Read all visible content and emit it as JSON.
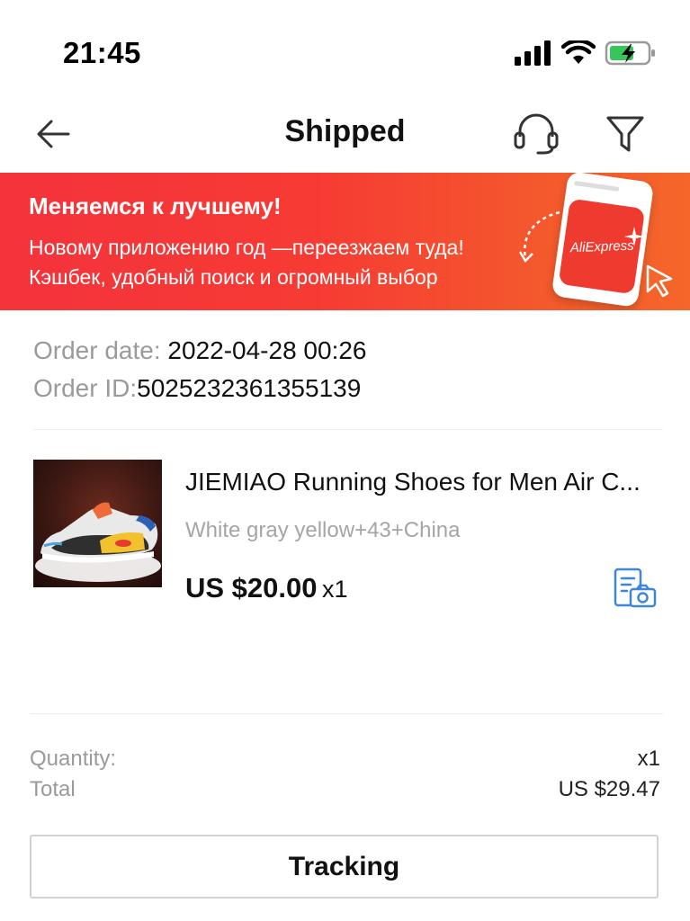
{
  "status_bar": {
    "time": "21:45"
  },
  "header": {
    "title": "Shipped",
    "icons": [
      "back-arrow-icon",
      "headset-icon",
      "filter-icon"
    ]
  },
  "banner": {
    "title": "Меняемся к лучшему!",
    "line1": "Новому приложению год —переезжаем туда!",
    "line2": "Кэшбек, удобный поиск и огромный выбор",
    "app_label": "AliExpress",
    "colors": {
      "start": "#f4333b",
      "end": "#f5662a"
    }
  },
  "order": {
    "date_label": "Order date:",
    "date_value": "2022-04-28 00:26",
    "id_label": "Order ID:",
    "id_value": "5025232361355139"
  },
  "product": {
    "title": "JIEMIAO Running Shoes for Men Air C...",
    "variant": "White gray yellow+43+China",
    "price": "US $20.00",
    "quantity": "x1",
    "photo_review_icon": "photo-review-icon",
    "icon_color": "#3f87d6"
  },
  "summary": {
    "quantity_label": "Quantity:",
    "quantity_value": "x1",
    "total_label": "Total",
    "total_value": "US $29.47"
  },
  "actions": {
    "tracking_label": "Tracking"
  }
}
